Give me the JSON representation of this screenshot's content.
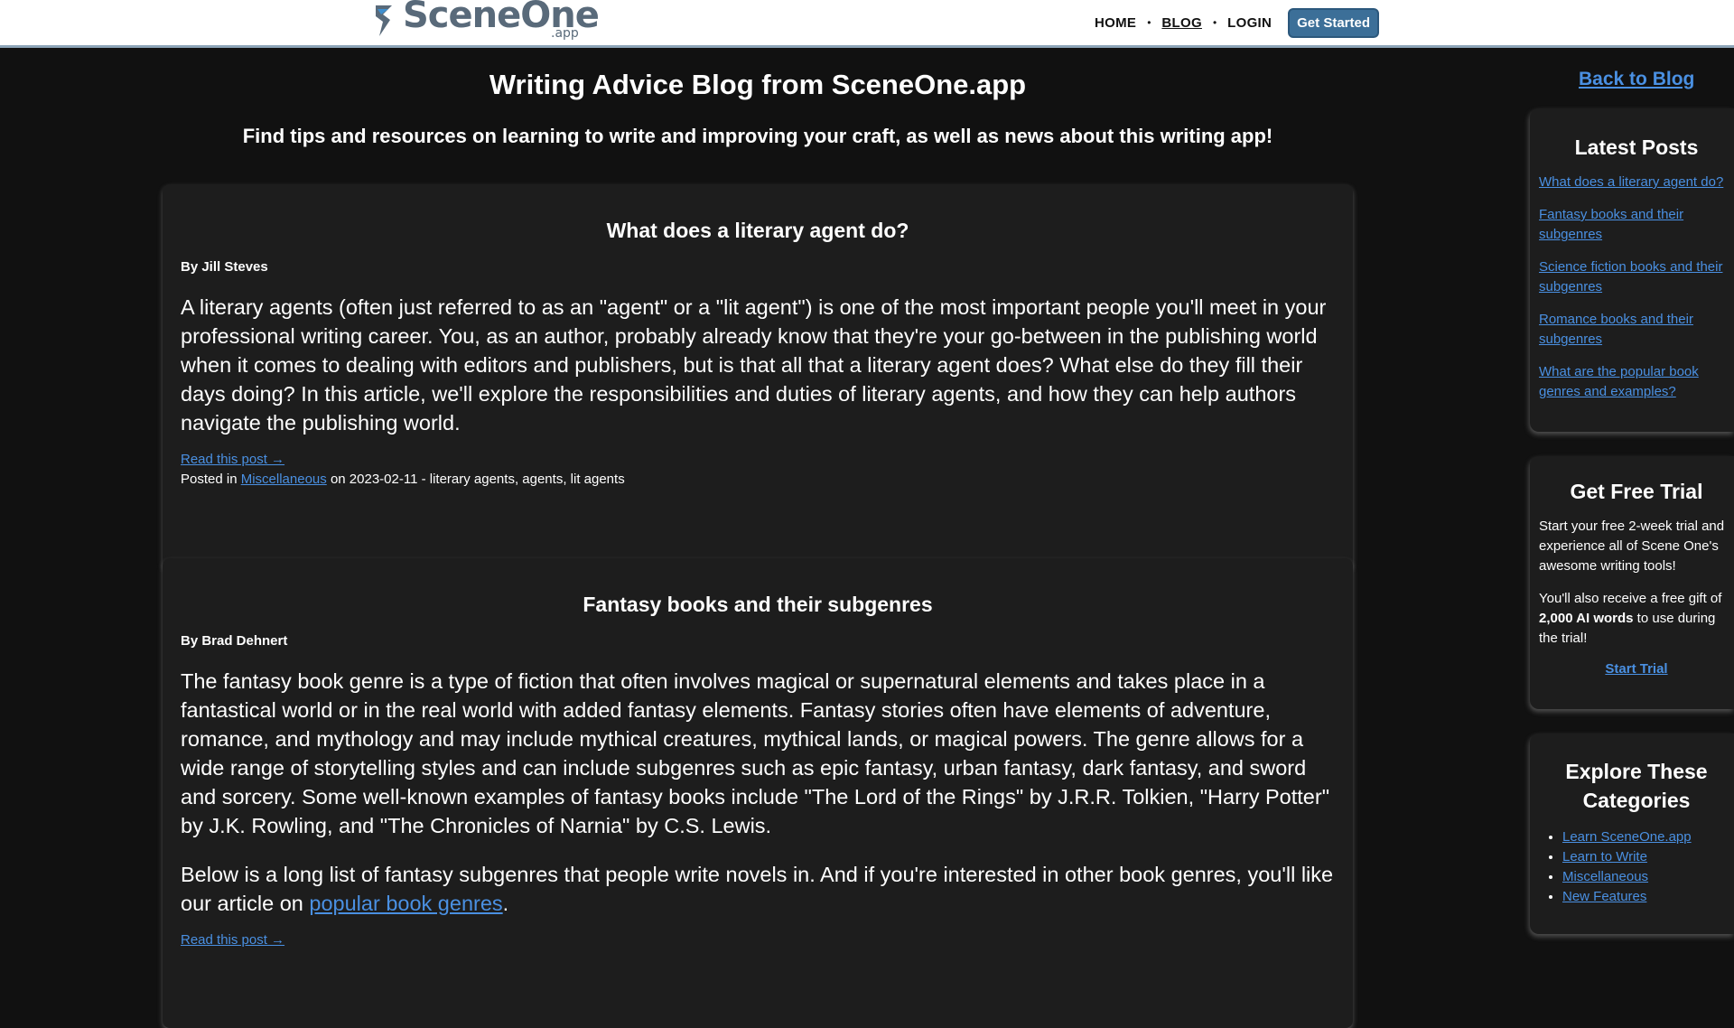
{
  "header": {
    "logo_text": "SceneOne",
    "logo_sub": ".app",
    "nav": [
      "HOME",
      "BLOG",
      "LOGIN"
    ],
    "cta": "Get Started"
  },
  "main": {
    "title": "Writing Advice Blog from SceneOne.app",
    "subtitle": "Find tips and resources on learning to write and improving your craft, as well as news about this writing app!",
    "posts": [
      {
        "title": "What does a literary agent do?",
        "author": "By Jill Steves",
        "body": "A literary agents (often just referred to as an \"agent\" or a \"lit agent\") is one of the most important people you'll meet in your professional writing career. You, as an author, probably already know that they're your go-between in the publishing world when it comes to dealing with editors and publishers, but is that all that a literary agent does? What else do they fill their days doing? In this article, we'll explore the responsibilities and duties of literary agents, and how they can help authors navigate the publishing world.",
        "read_more": "Read this post →",
        "posted_in": "Posted in",
        "category": "Miscellaneous",
        "meta_rest": "on 2023-02-11 - literary agents, agents, lit agents"
      },
      {
        "title": "Fantasy books and their subgenres",
        "author": "By Brad Dehnert",
        "body": "The fantasy book genre is a type of fiction that often involves magical or supernatural elements and takes place in a fantastical world or in the real world with added fantasy elements. Fantasy stories often have elements of adventure, romance, and mythology and may include mythical creatures, mythical lands, or magical powers. The genre allows for a wide range of storytelling styles and can include subgenres such as epic fantasy, urban fantasy, dark fantasy, and sword and sorcery. Some well-known examples of fantasy books include \"The Lord of the Rings\" by J.R.R. Tolkien, \"Harry Potter\" by J.K. Rowling, and \"The Chronicles of Narnia\" by C.S. Lewis.",
        "body2_pre": "Below is a long list of fantasy subgenres that people write novels in. And if you're interested in other book genres, you'll like our article on",
        "body2_link": "popular book genres",
        "body2_post": ".",
        "read_more": "Read this post →"
      }
    ]
  },
  "sidebar": {
    "back": "Back to Blog",
    "latest_title": "Latest Posts",
    "latest": [
      "What does a literary agent do?",
      "Fantasy books and their subgenres",
      "Science fiction books and their subgenres",
      "Romance books and their subgenres",
      "What are the popular book genres and examples?"
    ],
    "trial_title": "Get Free Trial",
    "trial_p1": "Start your free 2-week trial and experience all of Scene One's awesome writing tools!",
    "trial_p2_pre": "You'll also receive a free gift of",
    "trial_p2_bold": "2,000 AI words",
    "trial_p2_post": "to use during the trial!",
    "trial_cta": "Start Trial",
    "cats_title": "Explore These Categories",
    "cats": [
      "Learn SceneOne.app",
      "Learn to Write",
      "Miscellaneous",
      "New Features"
    ]
  },
  "colors": {
    "background": "#111111",
    "card": "#1d1d1d",
    "link": "#4a90e2",
    "header_bg": "#ffffff",
    "cta_bg": "#3c6f98",
    "logo": "#596a7a"
  }
}
